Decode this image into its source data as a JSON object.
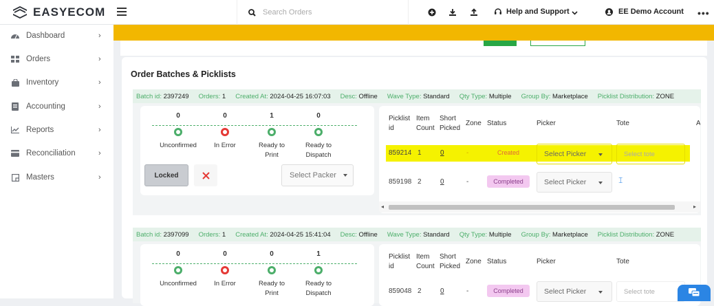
{
  "app": {
    "brand": "EASYECOM"
  },
  "topbar": {
    "search_placeholder": "Search Orders",
    "help_label": "Help and Support",
    "account_label": "EE Demo Account",
    "more_label": "•••"
  },
  "sidebar": {
    "items": [
      {
        "label": "Dashboard",
        "icon": "dashboard-icon"
      },
      {
        "label": "Orders",
        "icon": "grid-icon"
      },
      {
        "label": "Inventory",
        "icon": "bag-icon"
      },
      {
        "label": "Accounting",
        "icon": "ledger-icon"
      },
      {
        "label": "Reports",
        "icon": "line-chart-icon"
      },
      {
        "label": "Reconciliation",
        "icon": "card-icon"
      },
      {
        "label": "Masters",
        "icon": "note-icon"
      }
    ]
  },
  "page": {
    "title": "Order Batches & Picklists"
  },
  "batches": [
    {
      "header": {
        "batch_id_k": "Batch id:",
        "batch_id": "2397249",
        "orders_k": "Orders:",
        "orders": "1",
        "created_k": "Created At:",
        "created": "2024-04-25 16:07:03",
        "desc_k": "Desc:",
        "desc": "Offline",
        "wave_k": "Wave Type:",
        "wave": "Standard",
        "qty_k": "Qty Type:",
        "qty": "Multiple",
        "group_k": "Group By:",
        "group": "Marketplace",
        "dist_k": "Picklist Distribution:",
        "dist": "ZONE"
      },
      "stages": [
        {
          "count": "0",
          "l1": "Unconfirmed",
          "l2": ""
        },
        {
          "count": "0",
          "l1": "In Error",
          "l2": ""
        },
        {
          "count": "1",
          "l1": "Ready to",
          "l2": "Print"
        },
        {
          "count": "0",
          "l1": "Ready to",
          "l2": "Dispatch"
        }
      ],
      "locked_label": "Locked",
      "packer_placeholder": "Select Packer",
      "table_headers": {
        "picklist_id_1": "Picklist",
        "picklist_id_2": "id",
        "item_count_1": "Item",
        "item_count_2": "Count",
        "short_picked_1": "Short",
        "short_picked_2": "Picked",
        "zone": "Zone",
        "status": "Status",
        "picker": "Picker",
        "tote": "Tote",
        "last": "A"
      },
      "rows": [
        {
          "picklist_id": "859214",
          "item_count": "1",
          "short_picked": "0",
          "zone": "-",
          "status": "Created",
          "picker": "Select Picker",
          "tote": "Select tote"
        },
        {
          "picklist_id": "859198",
          "item_count": "2",
          "short_picked": "0",
          "zone": "-",
          "status": "Completed",
          "picker": "Select Picker",
          "tote": ""
        }
      ]
    },
    {
      "header": {
        "batch_id_k": "Batch id:",
        "batch_id": "2397099",
        "orders_k": "Orders:",
        "orders": "1",
        "created_k": "Created At:",
        "created": "2024-04-25 15:41:04",
        "desc_k": "Desc:",
        "desc": "Offline",
        "wave_k": "Wave Type:",
        "wave": "Standard",
        "qty_k": "Qty Type:",
        "qty": "Multiple",
        "group_k": "Group By:",
        "group": "Marketplace",
        "dist_k": "Picklist Distribution:",
        "dist": "ZONE"
      },
      "stages": [
        {
          "count": "0",
          "l1": "Unconfirmed",
          "l2": ""
        },
        {
          "count": "0",
          "l1": "In Error",
          "l2": ""
        },
        {
          "count": "0",
          "l1": "Ready to",
          "l2": "Print"
        },
        {
          "count": "1",
          "l1": "Ready to",
          "l2": "Dispatch"
        }
      ],
      "table_headers": {
        "picklist_id_1": "Picklist",
        "picklist_id_2": "id",
        "item_count_1": "Item",
        "item_count_2": "Count",
        "short_picked_1": "Short",
        "short_picked_2": "Picked",
        "zone": "Zone",
        "status": "Status",
        "picker": "Picker",
        "tote": "Tote"
      },
      "rows": [
        {
          "picklist_id": "859048",
          "item_count": "2",
          "short_picked": "0",
          "zone": "-",
          "status": "Completed",
          "picker": "Select Picker",
          "tote": "Select tote"
        }
      ]
    }
  ],
  "colors": {
    "accent_yellow": "#f2b700",
    "success_green": "#28a745",
    "error_red": "#e53935",
    "highlight": "#f5f200",
    "completed_badge": "#f3c8f0"
  }
}
